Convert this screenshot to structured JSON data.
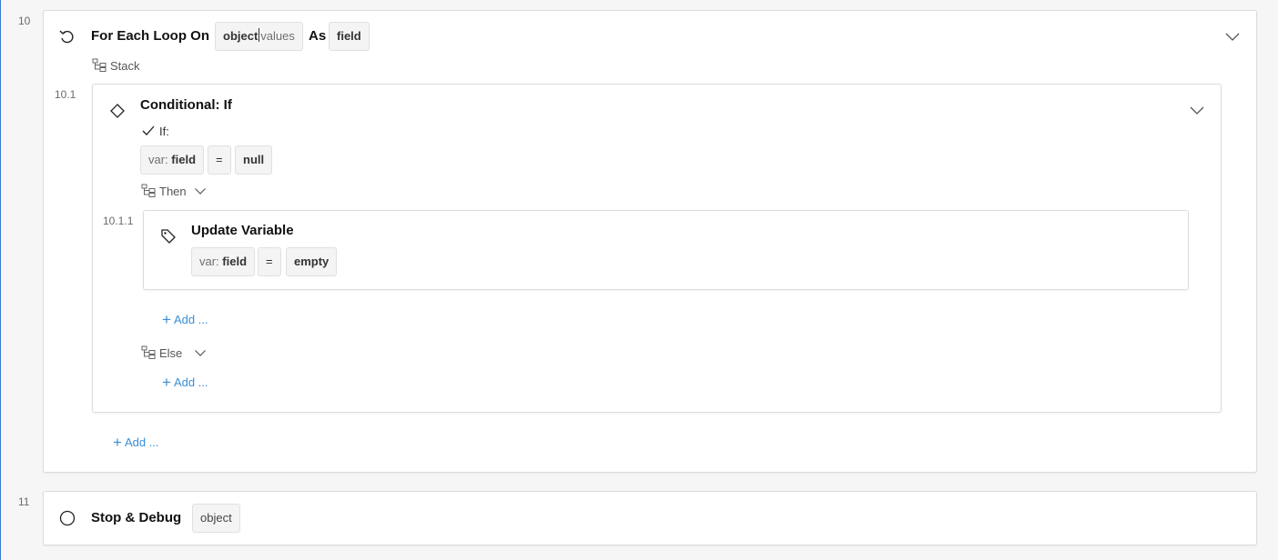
{
  "steps": {
    "loop": {
      "number": "10",
      "title": "For Each Loop On",
      "source_object": "object",
      "source_field": "values",
      "as_label": "As",
      "as_var": "field",
      "stack_label": "Stack",
      "add_label": "Add ..."
    },
    "conditional": {
      "number": "10.1",
      "title": "Conditional: If",
      "if_label": "If:",
      "cond_var_prefix": "var:",
      "cond_var_name": "field",
      "cond_op": "=",
      "cond_value": "null",
      "then_label": "Then",
      "else_label": "Else",
      "then_add_label": "Add ...",
      "else_add_label": "Add ..."
    },
    "update": {
      "number": "10.1.1",
      "title": "Update Variable",
      "var_prefix": "var:",
      "var_name": "field",
      "op": "=",
      "value": "empty"
    },
    "stop": {
      "number": "11",
      "title": "Stop & Debug",
      "arg": "object"
    }
  },
  "icons": {
    "loop": "loop-icon",
    "stack": "stack-icon",
    "conditional": "diamond-icon",
    "check": "check-icon",
    "tag": "tag-icon",
    "stop": "circle-icon",
    "chevron": "chevron-down-icon"
  },
  "colors": {
    "accent_blue": "#3a8ed4",
    "left_rule": "#3a78d4",
    "card_border": "#dcdcdc",
    "pill_bg": "#f4f4f4"
  }
}
